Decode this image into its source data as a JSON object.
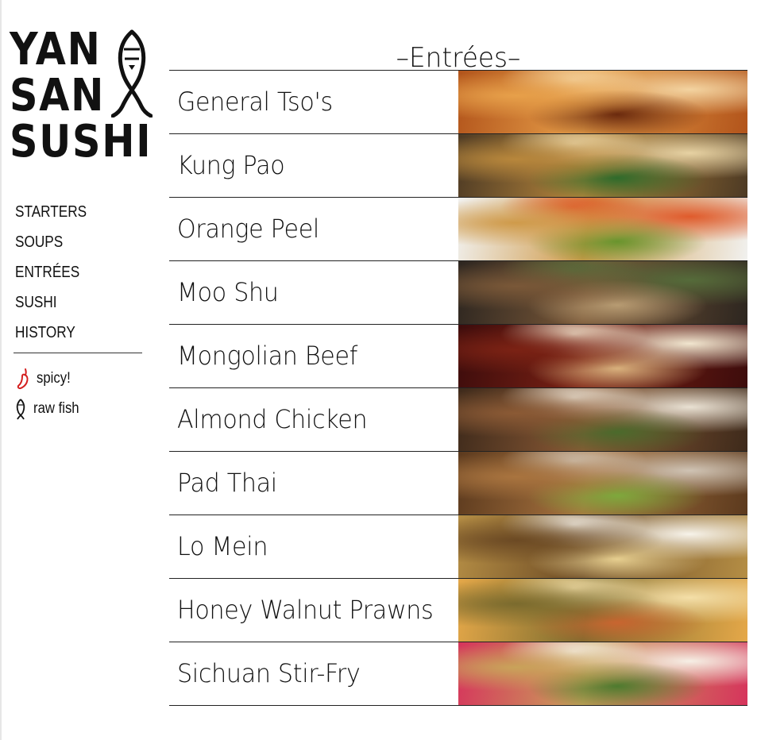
{
  "logo": {
    "line1": "YAN",
    "line2": "SAN",
    "line3": "SUSHI"
  },
  "nav": {
    "items": [
      "STARTERS",
      "SOUPS",
      "ENTRÉES",
      "SUSHI",
      "HISTORY"
    ]
  },
  "legend": [
    {
      "icon": "chili-pepper-icon",
      "label": "spicy!",
      "color": "#d42020"
    },
    {
      "icon": "fish-icon",
      "label": "raw fish",
      "color": "#111111"
    }
  ],
  "page_title": "–Entrées–",
  "entrees": [
    {
      "name": "General Tso's",
      "photo": "general-tso-photo",
      "colors": [
        "#b2541b",
        "#e7a04a",
        "#6b2a0e",
        "#f3d3a0"
      ]
    },
    {
      "name": "Kung Pao",
      "photo": "kung-pao-photo",
      "colors": [
        "#4d3a24",
        "#b8873c",
        "#2f6b2b",
        "#e7d2a3"
      ]
    },
    {
      "name": "Orange Peel",
      "photo": "orange-peel-photo",
      "colors": [
        "#f1f1ef",
        "#cf9a4a",
        "#69942d",
        "#e05b2c"
      ]
    },
    {
      "name": "Moo Shu",
      "photo": "moo-shu-photo",
      "colors": [
        "#2d2620",
        "#7a5838",
        "#b79b72",
        "#556b3a"
      ]
    },
    {
      "name": "Mongolian Beef",
      "photo": "mongolian-beef-photo",
      "colors": [
        "#3d0c0c",
        "#7b2214",
        "#d8b07c",
        "#f1e6cf"
      ]
    },
    {
      "name": "Almond Chicken",
      "photo": "almond-chicken-photo",
      "colors": [
        "#3e2a1b",
        "#8b5a35",
        "#4b6a2c",
        "#e9e1d3"
      ]
    },
    {
      "name": "Pad Thai",
      "photo": "pad-thai-photo",
      "colors": [
        "#5c3a1e",
        "#a9743f",
        "#7ea83c",
        "#cfc3b4"
      ]
    },
    {
      "name": "Lo Mein",
      "photo": "lo-mein-photo",
      "colors": [
        "#b58e45",
        "#6c4a24",
        "#e6ce8f",
        "#f7f3ea"
      ]
    },
    {
      "name": "Honey Walnut Prawns",
      "photo": "honey-walnut-prawns-photo",
      "colors": [
        "#e5a849",
        "#7b6b2e",
        "#c86530",
        "#f4dfa8"
      ]
    },
    {
      "name": "Sichuan Stir-Fry",
      "photo": "sichuan-stir-fry-photo",
      "colors": [
        "#d6345c",
        "#c9a35a",
        "#4e7b2f",
        "#f6efe5"
      ]
    }
  ]
}
